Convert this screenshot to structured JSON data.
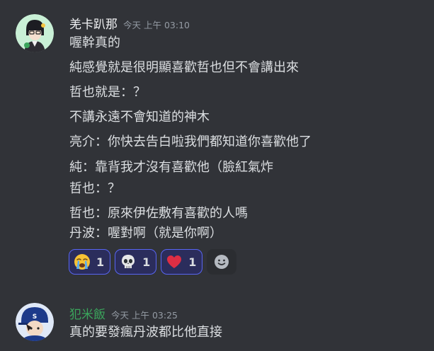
{
  "colors": {
    "background": "#313338",
    "text": "#dbdee1",
    "muted": "#949ba4",
    "reaction_bg": "#2b2d5c",
    "reaction_border": "#5865f2",
    "user2_name": "#3ba55c"
  },
  "messages": [
    {
      "username": "羌卡趴那",
      "timestamp": "今天 上午 03:10",
      "avatar": "anime-character-avatar",
      "lines": [
        "喔幹真的",
        "純感覺就是很明顯喜歡哲也但不會講出來",
        "哲也就是：？",
        "不講永遠不會知道的神木",
        "亮介：你快去告白啦我們都知道你喜歡他了",
        "純：靠背我才沒有喜歡他（臉紅氣炸",
        "哲也：？",
        "哲也：原來伊佐敷有喜歡的人嗎",
        "丹波：喔對啊（就是你啊）"
      ],
      "reactions": [
        {
          "icon": "loudly-crying-face-emoji",
          "count": "1"
        },
        {
          "icon": "skull-emoji",
          "count": "1"
        },
        {
          "icon": "red-heart-emoji",
          "count": "1"
        }
      ]
    },
    {
      "username": "犯米飯",
      "timestamp": "今天 上午 03:25",
      "avatar": "anime-baseball-player-avatar",
      "lines": [
        "真的要發瘋丹波都比他直接"
      ]
    }
  ]
}
